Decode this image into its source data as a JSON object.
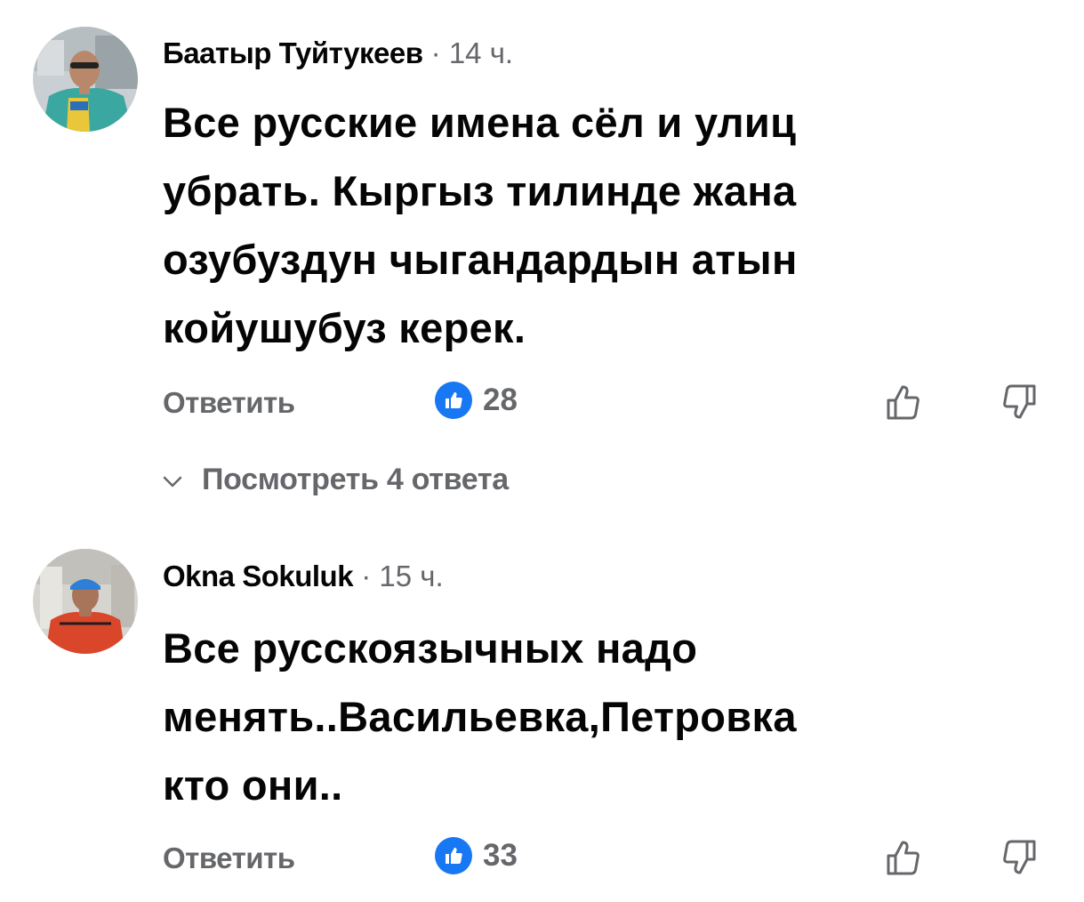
{
  "comments": [
    {
      "author": "Баатыр Туйтукеев",
      "separator": "·",
      "time": "14 ч.",
      "text_lines": [
        "Все русские имена сёл и улиц",
        "убрать. Кыргыз тилинде жана",
        "озубуздун чыгандардын атын",
        "койушубуз керек."
      ],
      "reply_label": "Ответить",
      "like_count": "28",
      "view_replies_label": "Посмотреть 4 ответа",
      "icons": {
        "like_badge": "thumbs-up-icon",
        "upvote": "thumbs-up-outline-icon",
        "downvote": "thumbs-down-outline-icon",
        "expand": "chevron-down-icon"
      }
    },
    {
      "author": "Okna Sokuluk",
      "separator": "·",
      "time": "15 ч.",
      "text_lines": [
        "Все русскоязычных надо",
        "менять..Васильевка,Петровка",
        "кто они.."
      ],
      "reply_label": "Ответить",
      "like_count": "33",
      "icons": {
        "like_badge": "thumbs-up-icon",
        "upvote": "thumbs-up-outline-icon",
        "downvote": "thumbs-down-outline-icon"
      }
    }
  ],
  "colors": {
    "text_primary": "#050505",
    "text_secondary": "#65676b",
    "like_blue": "#1877f2",
    "background": "#ffffff"
  }
}
